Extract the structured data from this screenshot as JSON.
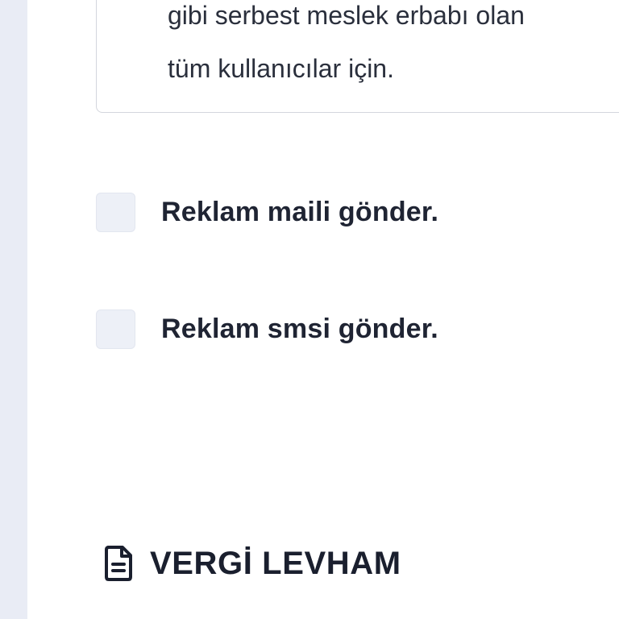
{
  "info_card": {
    "line_1": "gibi serbest meslek erbabı olan",
    "line_2": "tüm kullanıcılar için."
  },
  "options": [
    {
      "label": "Reklam maili gönder.",
      "checked": false
    },
    {
      "label": "Reklam smsi gönder.",
      "checked": false
    }
  ],
  "tax_section": {
    "title": "VERGİ LEVHAM",
    "icon": "document-icon"
  },
  "colors": {
    "rail": "#e9ecf5",
    "checkbox_fill": "#edf0f7",
    "text": "#1f2433"
  }
}
